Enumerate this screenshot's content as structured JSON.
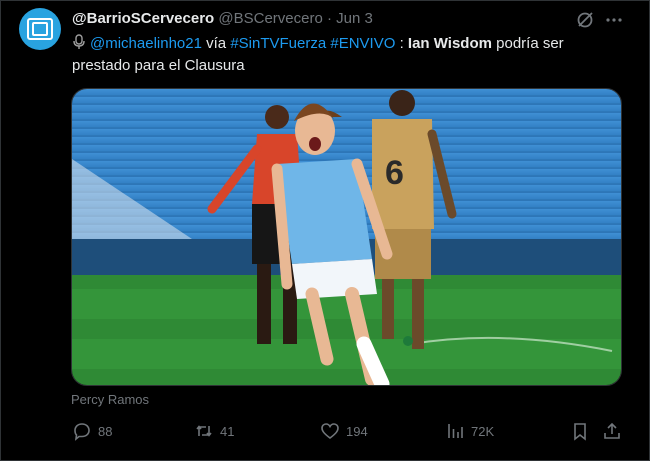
{
  "tweet": {
    "display_name": "@BarrioSCervecero",
    "handle": "@BSCervecero",
    "separator": "·",
    "date": "Jun 3",
    "text_parts": {
      "mention": "@michaelinho21",
      "via": " vía ",
      "tag1": "#SinTVFuerza",
      "tag2": "#ENVIVO",
      "colon": " : ",
      "bold_name": "Ian Wisdom",
      "rest": " podría ser prestado para el Clausura"
    },
    "media_credit": "Percy Ramos"
  },
  "actions": {
    "replies": "88",
    "reposts": "41",
    "likes": "194",
    "views": "72K"
  },
  "icons": [
    "avatar",
    "grok-icon",
    "more-icon",
    "mic-icon",
    "reply-icon",
    "repost-icon",
    "like-icon",
    "views-icon",
    "bookmark-icon",
    "share-icon"
  ],
  "colors": {
    "link": "#1d9bf0",
    "muted": "#71767b",
    "text": "#e7e9ea",
    "background": "#000000"
  }
}
